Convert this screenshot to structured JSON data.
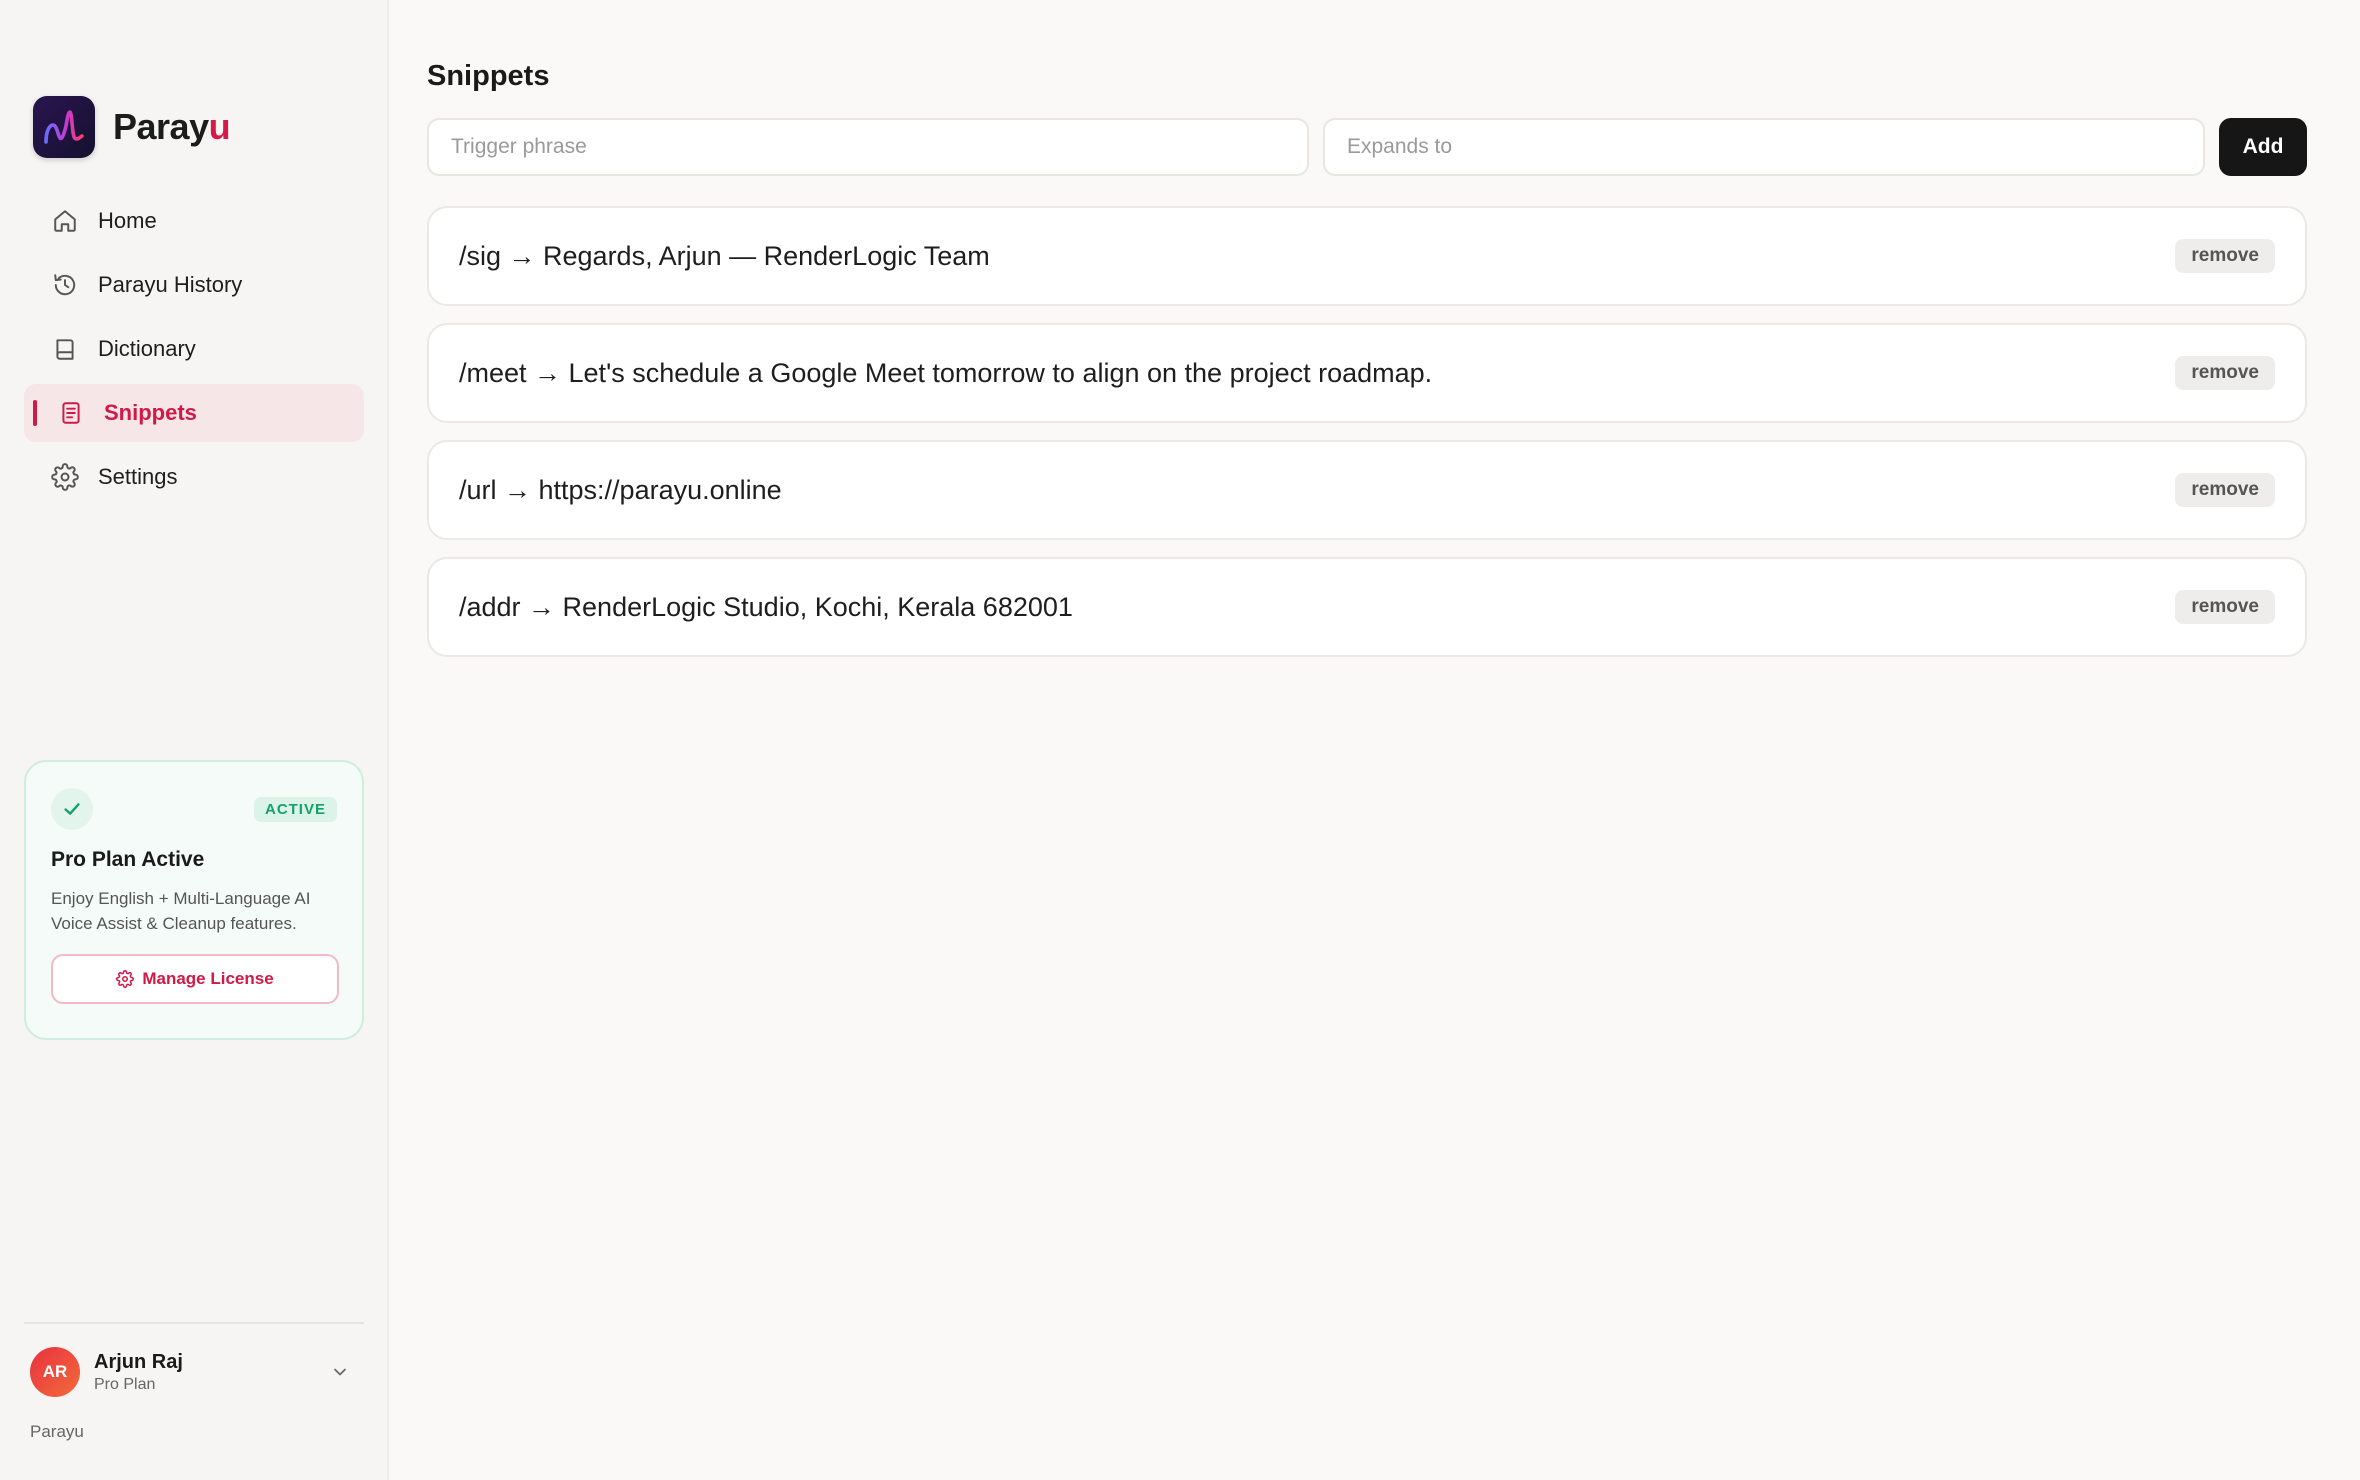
{
  "app": {
    "name_main": "Paray",
    "name_accent": "u"
  },
  "colors": {
    "accent": "#d11947",
    "success": "#16a06a",
    "primary_button": "#161616"
  },
  "sidebar": {
    "items": [
      {
        "label": "Home",
        "icon": "home-icon",
        "active": false
      },
      {
        "label": "Parayu History",
        "icon": "history-icon",
        "active": false
      },
      {
        "label": "Dictionary",
        "icon": "book-icon",
        "active": false
      },
      {
        "label": "Snippets",
        "icon": "document-icon",
        "active": true
      },
      {
        "label": "Settings",
        "icon": "gear-icon",
        "active": false
      }
    ],
    "pro_card": {
      "badge": "ACTIVE",
      "title": "Pro Plan Active",
      "description_line1": "Enjoy English + Multi-Language AI",
      "description_line2": "Voice Assist & Cleanup features.",
      "button_label": "Manage License"
    },
    "user": {
      "initials": "AR",
      "name": "Arjun Raj",
      "plan": "Pro Plan"
    },
    "footer": "Parayu"
  },
  "main": {
    "title": "Snippets",
    "trigger_input": {
      "placeholder": "Trigger phrase",
      "value": ""
    },
    "expands_input": {
      "placeholder": "Expands to",
      "value": ""
    },
    "add_label": "Add",
    "snippets": [
      {
        "text": "/sig → Regards, Arjun — RenderLogic Team",
        "remove_label": "remove"
      },
      {
        "text": "/meet → Let's schedule a Google Meet tomorrow to align on the project roadmap.",
        "remove_label": "remove"
      },
      {
        "text": "/url → https://parayu.online",
        "remove_label": "remove"
      },
      {
        "text": "/addr → RenderLogic Studio, Kochi, Kerala 682001",
        "remove_label": "remove"
      }
    ]
  }
}
